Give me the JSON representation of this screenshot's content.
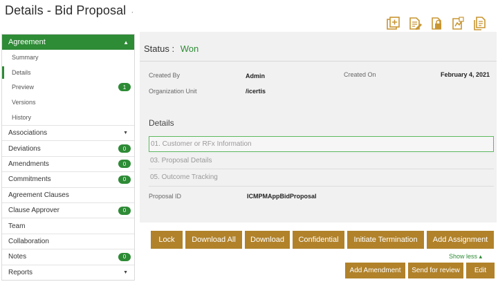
{
  "page": {
    "title": "Details - Bid Proposal",
    "title_suffix": "·"
  },
  "toolbar": {
    "icons": [
      "add-document-icon",
      "edit-document-icon",
      "lock-document-icon",
      "compare-document-icon",
      "copy-document-icon"
    ]
  },
  "colors": {
    "accent_green": "#2e8b36",
    "button_gold": "#b1822a"
  },
  "sidebar": {
    "section": {
      "label": "Agreement",
      "caret": "▲"
    },
    "sub_items": [
      {
        "label": "Summary"
      },
      {
        "label": "Details"
      },
      {
        "label": "Preview",
        "badge": "1"
      },
      {
        "label": "Versions"
      },
      {
        "label": "History"
      }
    ],
    "items": [
      {
        "label": "Associations",
        "caret": "▼"
      },
      {
        "label": "Deviations",
        "badge": "0"
      },
      {
        "label": "Amendments",
        "badge": "0"
      },
      {
        "label": "Commitments",
        "badge": "0"
      },
      {
        "label": "Agreement Clauses"
      },
      {
        "label": "Clause Approver",
        "badge": "0"
      },
      {
        "label": "Team"
      },
      {
        "label": "Collaboration"
      },
      {
        "label": "Notes",
        "badge": "0"
      },
      {
        "label": "Reports",
        "caret": "▼"
      }
    ]
  },
  "main": {
    "status_label": "Status :",
    "status_value": "Won",
    "created_by_label": "Created By",
    "created_by_value": "Admin",
    "created_on_label": "Created On",
    "created_on_value": "February 4, 2021",
    "org_unit_label": "Organization Unit",
    "org_unit_value": "/icertis",
    "details_heading": "Details",
    "sections": [
      "01. Customer or RFx Information",
      "03. Proposal Details",
      "05. Outcome Tracking"
    ],
    "proposal_id_label": "Proposal ID",
    "proposal_id_value": "ICMPMAppBidProposal"
  },
  "actions": {
    "lock": "Lock",
    "download_all": "Download All",
    "download": "Download",
    "confidential": "Confidential",
    "initiate_termination": "Initiate Termination",
    "add_assignment": "Add Assignment",
    "show_less": "Show less ▴",
    "add_amendment": "Add Amendment",
    "send_for_review": "Send for review",
    "edit": "Edit"
  }
}
